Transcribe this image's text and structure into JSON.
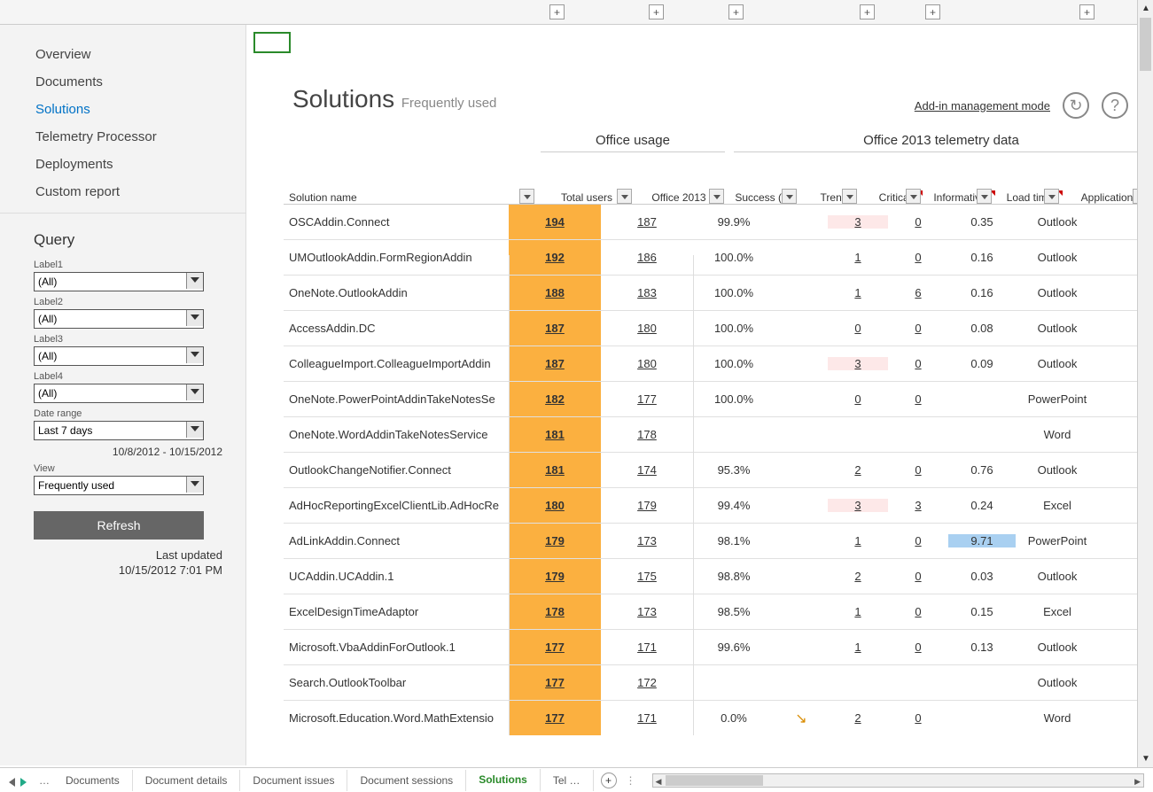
{
  "nav": {
    "items": [
      "Overview",
      "Documents",
      "Solutions",
      "Telemetry Processor",
      "Deployments",
      "Custom report"
    ],
    "active": 2
  },
  "query": {
    "title": "Query",
    "label1": "Label1",
    "v1": "(All)",
    "label2": "Label2",
    "v2": "(All)",
    "label3": "Label3",
    "v3": "(All)",
    "label4": "Label4",
    "v4": "(All)",
    "date_label": "Date range",
    "date_v": "Last 7 days",
    "date_range": "10/8/2012 - 10/15/2012",
    "view_label": "View",
    "view_v": "Frequently used",
    "refresh": "Refresh",
    "last_updated_label": "Last updated",
    "last_updated": "10/15/2012 7:01 PM"
  },
  "header": {
    "title": "Solutions",
    "subtitle": "Frequently used",
    "mgmt_link": "Add-in management mode",
    "refresh_icon": "↻",
    "help_icon": "?"
  },
  "groups": {
    "g1": "Office usage",
    "g2": "Office 2013 telemetry data"
  },
  "cols": {
    "name": "Solution name",
    "total": "Total users",
    "o2013": "Office 2013",
    "succ": "Success (%)",
    "trend": "Trend",
    "crit": "Critical",
    "info": "Informative",
    "load": "Load time",
    "app": "Application"
  },
  "rows": [
    {
      "name": "OSCAddin.Connect",
      "total": "194",
      "o2013": "187",
      "succ": "99.9%",
      "trend": "",
      "crit": "3",
      "info": "0",
      "load": "0.35",
      "app": "Outlook",
      "crit_hl": true
    },
    {
      "name": "UMOutlookAddin.FormRegionAddin",
      "total": "192",
      "o2013": "186",
      "succ": "100.0%",
      "trend": "",
      "crit": "1",
      "info": "0",
      "load": "0.16",
      "app": "Outlook"
    },
    {
      "name": "OneNote.OutlookAddin",
      "total": "188",
      "o2013": "183",
      "succ": "100.0%",
      "trend": "",
      "crit": "1",
      "info": "6",
      "load": "0.16",
      "app": "Outlook"
    },
    {
      "name": "AccessAddin.DC",
      "total": "187",
      "o2013": "180",
      "succ": "100.0%",
      "trend": "",
      "crit": "0",
      "info": "0",
      "load": "0.08",
      "app": "Outlook"
    },
    {
      "name": "ColleagueImport.ColleagueImportAddin",
      "total": "187",
      "o2013": "180",
      "succ": "100.0%",
      "trend": "",
      "crit": "3",
      "info": "0",
      "load": "0.09",
      "app": "Outlook",
      "crit_hl": true
    },
    {
      "name": "OneNote.PowerPointAddinTakeNotesSe",
      "total": "182",
      "o2013": "177",
      "succ": "100.0%",
      "trend": "",
      "crit": "0",
      "info": "0",
      "load": "",
      "app": "PowerPoint"
    },
    {
      "name": "OneNote.WordAddinTakeNotesService",
      "total": "181",
      "o2013": "178",
      "succ": "",
      "trend": "",
      "crit": "",
      "info": "",
      "load": "",
      "app": "Word"
    },
    {
      "name": "OutlookChangeNotifier.Connect",
      "total": "181",
      "o2013": "174",
      "succ": "95.3%",
      "trend": "",
      "crit": "2",
      "info": "0",
      "load": "0.76",
      "app": "Outlook",
      "load_hl": false
    },
    {
      "name": "AdHocReportingExcelClientLib.AdHocRe",
      "total": "180",
      "o2013": "179",
      "succ": "99.4%",
      "trend": "",
      "crit": "3",
      "info": "3",
      "load": "0.24",
      "app": "Excel",
      "crit_hl": true
    },
    {
      "name": "AdLinkAddin.Connect",
      "total": "179",
      "o2013": "173",
      "succ": "98.1%",
      "trend": "",
      "crit": "1",
      "info": "0",
      "load": "9.71",
      "app": "PowerPoint",
      "load_hl": true
    },
    {
      "name": "UCAddin.UCAddin.1",
      "total": "179",
      "o2013": "175",
      "succ": "98.8%",
      "trend": "",
      "crit": "2",
      "info": "0",
      "load": "0.03",
      "app": "Outlook"
    },
    {
      "name": "ExcelDesignTimeAdaptor",
      "total": "178",
      "o2013": "173",
      "succ": "98.5%",
      "trend": "",
      "crit": "1",
      "info": "0",
      "load": "0.15",
      "app": "Excel"
    },
    {
      "name": "Microsoft.VbaAddinForOutlook.1",
      "total": "177",
      "o2013": "171",
      "succ": "99.6%",
      "trend": "",
      "crit": "1",
      "info": "0",
      "load": "0.13",
      "app": "Outlook"
    },
    {
      "name": "Search.OutlookToolbar",
      "total": "177",
      "o2013": "172",
      "succ": "",
      "trend": "",
      "crit": "",
      "info": "",
      "load": "",
      "app": "Outlook"
    },
    {
      "name": "Microsoft.Education.Word.MathExtensio",
      "total": "177",
      "o2013": "171",
      "succ": "0.0%",
      "trend": "↘",
      "crit": "2",
      "info": "0",
      "load": "",
      "app": "Word"
    }
  ],
  "tabs": {
    "items": [
      "Documents",
      "Document details",
      "Document issues",
      "Document sessions",
      "Solutions",
      "Tel …"
    ],
    "active": 4
  },
  "plus_positions": [
    620,
    732,
    822,
    970,
    1044,
    1218
  ]
}
